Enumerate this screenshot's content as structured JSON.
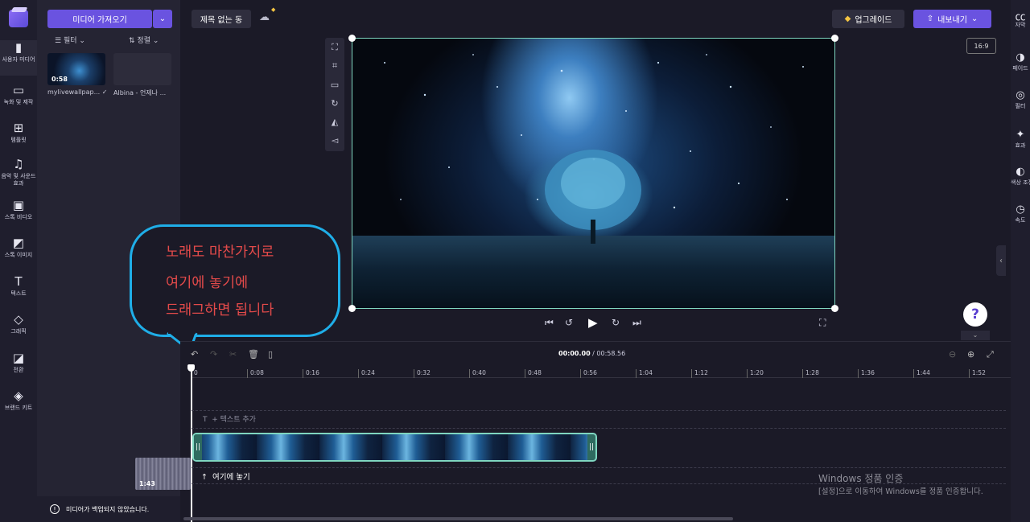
{
  "left_rail": {
    "items": [
      {
        "label": "사용자 미디어",
        "icon": "folder-icon"
      },
      {
        "label": "녹화 및 제작",
        "icon": "camera-icon"
      },
      {
        "label": "템플릿",
        "icon": "templates-icon"
      },
      {
        "label": "음악 및 사운드 효과",
        "icon": "music-icon"
      },
      {
        "label": "스톡 비디오",
        "icon": "film-icon"
      },
      {
        "label": "스톡 이미지",
        "icon": "image-icon"
      },
      {
        "label": "텍스트",
        "icon": "text-icon"
      },
      {
        "label": "그래픽",
        "icon": "shapes-icon"
      },
      {
        "label": "전환",
        "icon": "transition-icon"
      },
      {
        "label": "브랜드 키트",
        "icon": "brand-kit-icon"
      }
    ]
  },
  "media_panel": {
    "import_label": "미디어 가져오기",
    "filter_label": "필터",
    "sort_label": "정렬",
    "items": [
      {
        "name": "mylivewallpap...",
        "duration": "0:58"
      },
      {
        "name": "Albina - 언제나 ..."
      }
    ],
    "backup_notice": "미디어가 백업되지 않았습니다."
  },
  "top_bar": {
    "project_title": "제목 없는 동",
    "upgrade_label": "업그레이드",
    "export_label": "내보내기",
    "aspect_ratio": "16:9"
  },
  "right_rail": {
    "items": [
      {
        "label": "자막",
        "icon": "captions-icon"
      },
      {
        "label": "페이드",
        "icon": "fade-icon"
      },
      {
        "label": "필터",
        "icon": "filter-icon"
      },
      {
        "label": "효과",
        "icon": "magic-wand-icon"
      },
      {
        "label": "색상 조정",
        "icon": "contrast-icon"
      },
      {
        "label": "속도",
        "icon": "speed-icon"
      }
    ]
  },
  "callout": {
    "lines": [
      "노래도 마찬가지로",
      "여기에 놓기에",
      "드래그하면 됩니다"
    ]
  },
  "help_label": "?",
  "timeline": {
    "current_time": "00:00.00",
    "total_time": "00:58.56",
    "ruler": [
      "0",
      "0:08",
      "0:16",
      "0:24",
      "0:32",
      "0:40",
      "0:48",
      "0:56",
      "1:04",
      "1:12",
      "1:20",
      "1:28",
      "1:36",
      "1:44",
      "1:52"
    ],
    "text_add_label": "+ 텍스트 추가",
    "audio_duration": "1:43",
    "drop_label": "여기에 놓기"
  },
  "watermark": {
    "title": "Windows 정품 인증",
    "subtitle": "[설정]으로 이동하여 Windows를 정품 인증합니다."
  }
}
